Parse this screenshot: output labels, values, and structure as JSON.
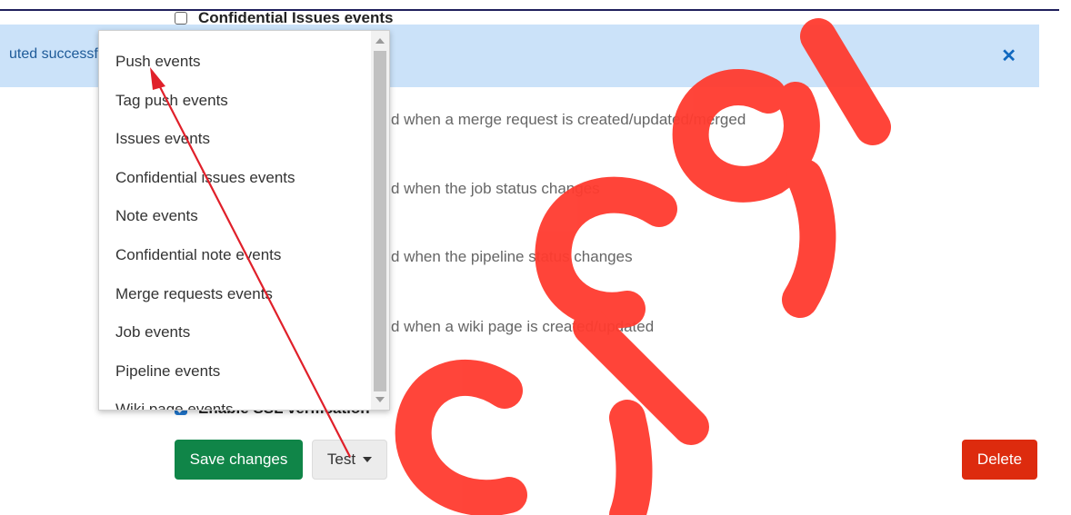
{
  "form": {
    "confidential_issues_label": "Confidential Issues events",
    "ssl_label": "Enable SSL verification",
    "merge_desc": "d when a merge request is created/updated/merged",
    "job_desc": "d when the job status changes",
    "pipeline_desc": "d when the pipeline status changes",
    "wiki_desc": "d when a wiki page is created/updated"
  },
  "flash": {
    "text": "uted successfully",
    "close_glyph": "✕"
  },
  "dropdown": {
    "items": [
      "Push events",
      "Tag push events",
      "Issues events",
      "Confidential issues events",
      "Note events",
      "Confidential note events",
      "Merge requests events",
      "Job events",
      "Pipeline events",
      "Wiki page events"
    ]
  },
  "actions": {
    "save_label": "Save changes",
    "test_label": "Test",
    "delete_label": "Delete"
  },
  "colors": {
    "flash_bg": "#cbe2f9",
    "save": "#108548",
    "delete": "#dd2b0e",
    "annotation_arrow": "#e0202a",
    "watermark": "#ff3b2f"
  },
  "icons": {
    "close": "close-icon",
    "caret": "chevron-down-icon",
    "arrow": "annotation-arrow"
  }
}
